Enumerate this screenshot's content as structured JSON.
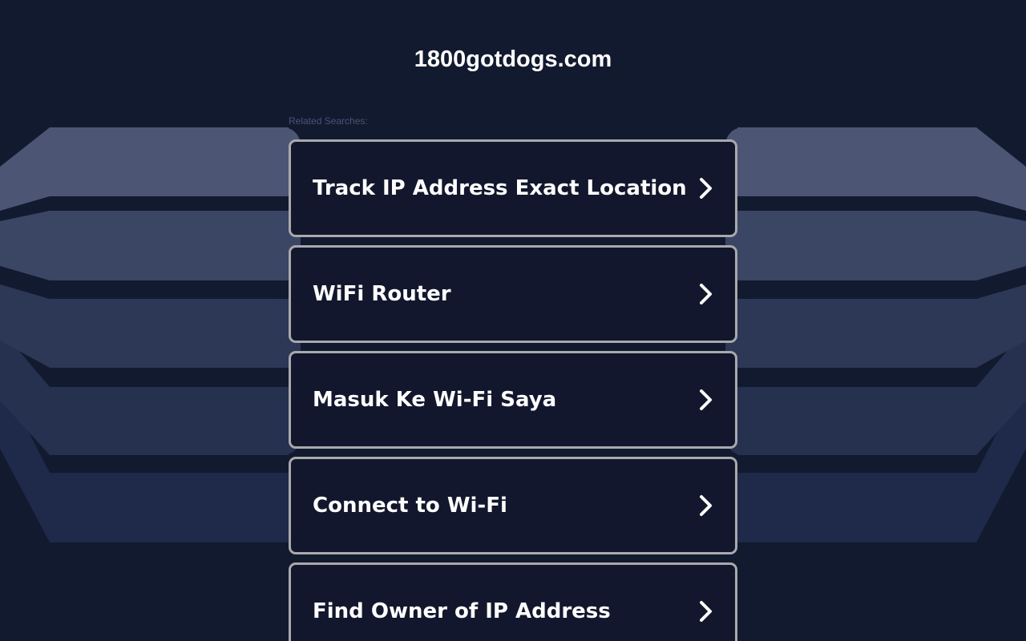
{
  "page": {
    "site_title": "1800gotdogs.com",
    "related_label": "Related Searches:"
  },
  "search_links": [
    {
      "label": "Track IP Address Exact Location",
      "icon": "chevron-right-icon"
    },
    {
      "label": "WiFi Router",
      "icon": "chevron-right-icon"
    },
    {
      "label": "Masuk Ke Wi-Fi Saya",
      "icon": "chevron-right-icon"
    },
    {
      "label": "Connect to Wi-Fi",
      "icon": "chevron-right-icon"
    },
    {
      "label": "Find Owner of IP Address",
      "icon": "chevron-right-icon"
    }
  ],
  "colors": {
    "background": "#121a2f",
    "card_background": "#12172d",
    "card_border": "#a9a9ad",
    "band_1": "#4c5574",
    "band_2": "#3b4564",
    "band_3": "#2d3756",
    "band_4": "#26304f",
    "band_5": "#1f2949"
  }
}
